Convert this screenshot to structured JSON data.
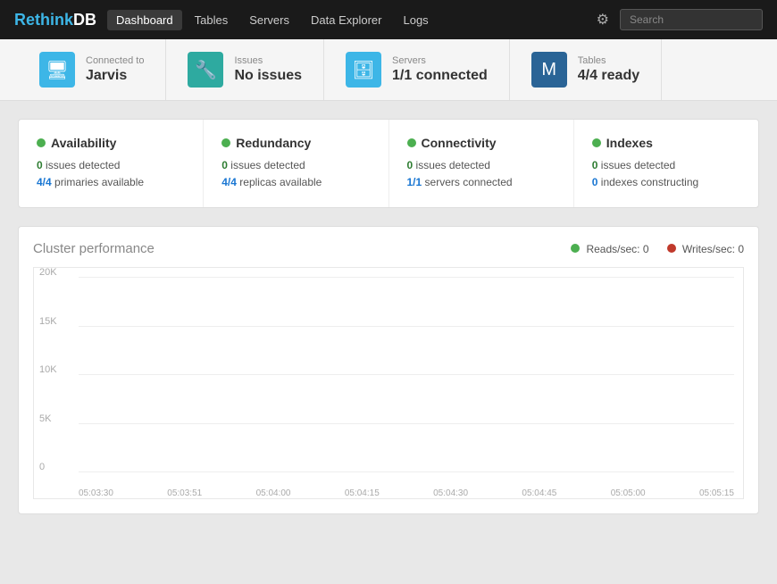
{
  "brand": {
    "name_part1": "Rethink",
    "name_part2": "DB"
  },
  "nav": {
    "links": [
      {
        "label": "Dashboard",
        "active": true
      },
      {
        "label": "Tables",
        "active": false
      },
      {
        "label": "Servers",
        "active": false
      },
      {
        "label": "Data Explorer",
        "active": false
      },
      {
        "label": "Logs",
        "active": false
      }
    ],
    "search_placeholder": "Search"
  },
  "status_bar": {
    "items": [
      {
        "icon": "monitor",
        "label": "Connected to",
        "value": "Jarvis"
      },
      {
        "icon": "wrench",
        "label": "Issues",
        "value": "No issues"
      },
      {
        "icon": "database",
        "label": "Servers",
        "value": "1/1 connected"
      },
      {
        "icon": "table",
        "label": "Tables",
        "value": "4/4 ready"
      }
    ]
  },
  "health": {
    "items": [
      {
        "title": "Availability",
        "issues": "0",
        "issues_label": "issues detected",
        "stat1_num": "4/4",
        "stat1_label": "primaries available"
      },
      {
        "title": "Redundancy",
        "issues": "0",
        "issues_label": "issues detected",
        "stat1_num": "4/4",
        "stat1_label": "replicas available"
      },
      {
        "title": "Connectivity",
        "issues": "0",
        "issues_label": "issues detected",
        "stat1_num": "1/1",
        "stat1_label": "servers connected"
      },
      {
        "title": "Indexes",
        "issues": "0",
        "issues_label": "issues detected",
        "stat1_num": "0",
        "stat1_label": "indexes constructing"
      }
    ]
  },
  "performance": {
    "title": "Cluster performance",
    "legend_reads": "Reads/sec: 0",
    "legend_writes": "Writes/sec: 0",
    "y_labels": [
      "20K",
      "15K",
      "10K",
      "5K",
      "0"
    ],
    "x_labels": [
      "05:03:30",
      "05:03:51",
      "05:04:00",
      "05:04:15",
      "05:04:30",
      "05:04:45",
      "05:05:00",
      "05:05:15"
    ]
  }
}
